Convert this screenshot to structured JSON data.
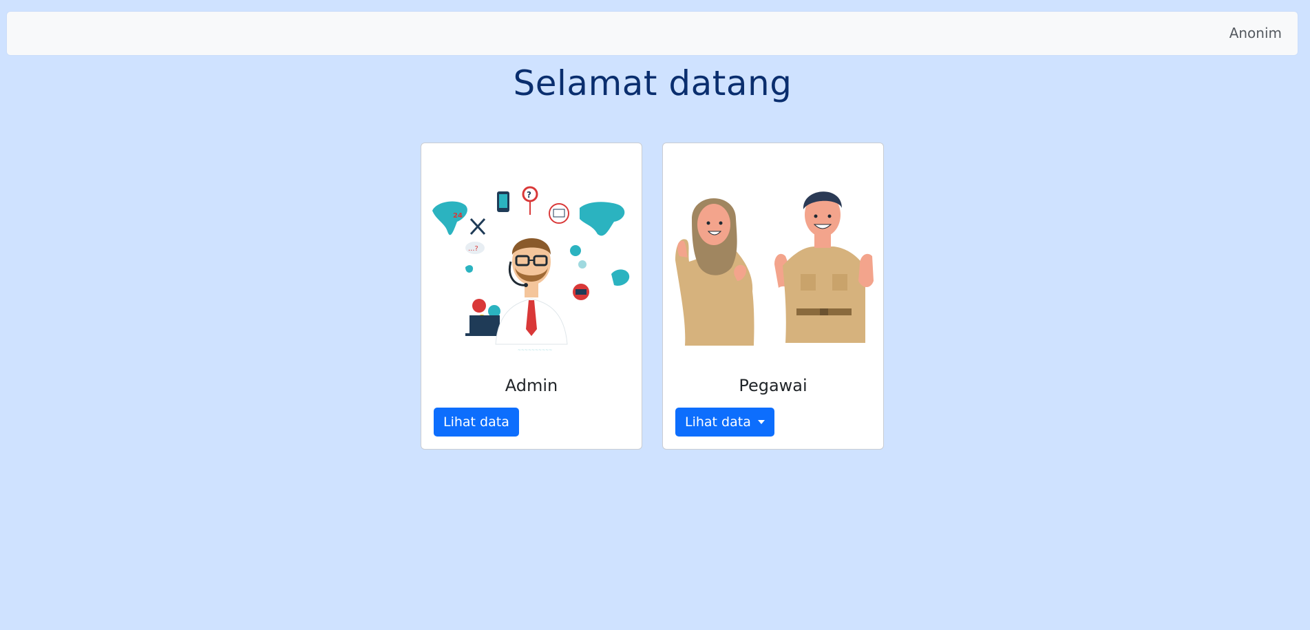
{
  "navbar": {
    "user_label": "Anonim"
  },
  "page": {
    "title": "Selamat datang"
  },
  "cards": [
    {
      "title": "Admin",
      "button_label": "Lihat data",
      "illustration": "customer-support-illustration"
    },
    {
      "title": "Pegawai",
      "button_label": "Lihat data",
      "illustration": "employees-illustration",
      "button_has_dropdown": true
    }
  ],
  "colors": {
    "background": "#cfe2ff",
    "primary": "#0d6efd",
    "title": "#0a2e6e"
  }
}
